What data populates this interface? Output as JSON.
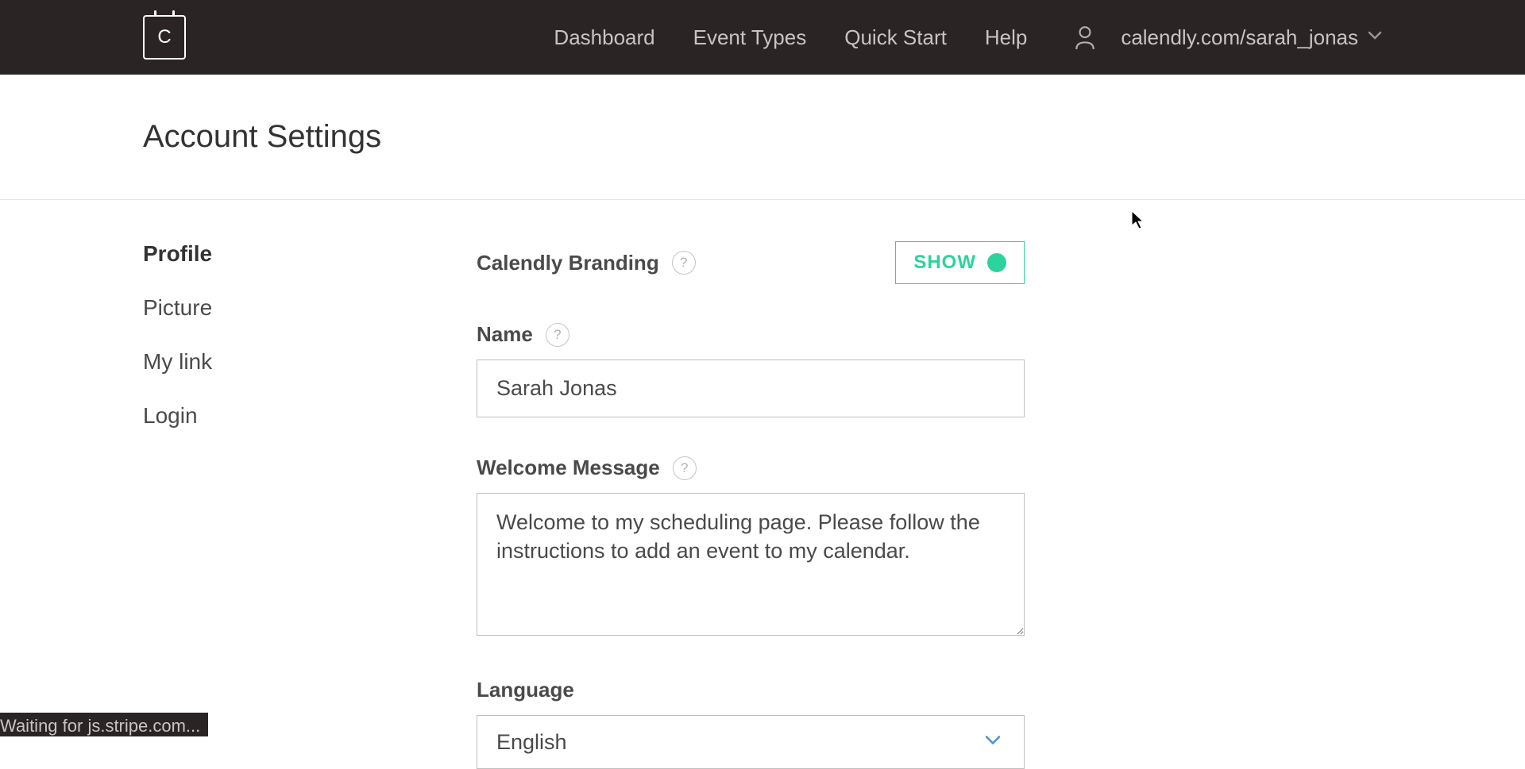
{
  "header": {
    "logo_letter": "C",
    "nav": [
      {
        "label": "Dashboard"
      },
      {
        "label": "Event Types"
      },
      {
        "label": "Quick Start"
      },
      {
        "label": "Help"
      }
    ],
    "user_url": "calendly.com/sarah_jonas"
  },
  "page": {
    "title": "Account Settings"
  },
  "sidebar": {
    "items": [
      {
        "label": "Profile",
        "active": true
      },
      {
        "label": "Picture",
        "active": false
      },
      {
        "label": "My link",
        "active": false
      },
      {
        "label": "Login",
        "active": false
      }
    ]
  },
  "form": {
    "branding_label": "Calendly Branding",
    "branding_toggle": "SHOW",
    "name_label": "Name",
    "name_value": "Sarah Jonas",
    "welcome_label": "Welcome Message",
    "welcome_value": "Welcome to my scheduling page. Please follow the instructions to add an event to my calendar.",
    "language_label": "Language",
    "language_value": "English",
    "help_glyph": "?"
  },
  "status_bar": "Waiting for js.stripe.com..."
}
